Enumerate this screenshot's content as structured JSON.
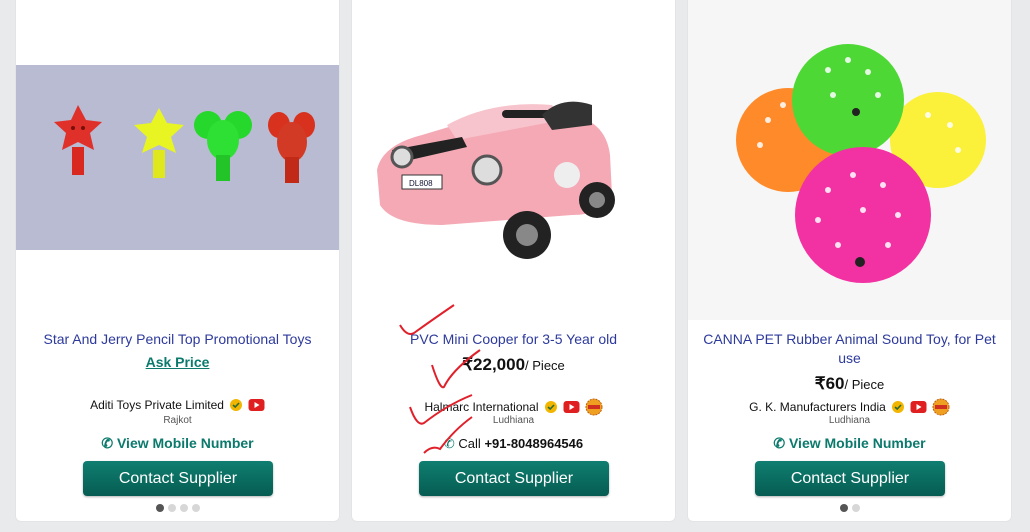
{
  "cards": [
    {
      "title": "Star And Jerry Pencil Top Promotional Toys",
      "ask_price": "Ask Price",
      "supplier": "Aditi Toys Private Limited",
      "city": "Rajkot",
      "mobile_label": "View Mobile Number",
      "button": "Contact Supplier"
    },
    {
      "title": "PVC Mini Cooper for 3-5 Year old",
      "price": "₹22,000",
      "unit": "/ Piece",
      "supplier": "Halmarc International",
      "city": "Ludhiana",
      "call_prefix": "Call",
      "phone": "+91-8048964546",
      "plate": "DL808",
      "button": "Contact Supplier"
    },
    {
      "title": "CANNA PET Rubber Animal Sound Toy, for Pet use",
      "price": "₹60",
      "unit": "/ Piece",
      "supplier": "G. K. Manufacturers India",
      "city": "Ludhiana",
      "mobile_label": "View Mobile Number",
      "button": "Contact Supplier"
    }
  ],
  "colors": {
    "button": "#0b6e63",
    "title_link": "#2d3a9c",
    "accent_green": "#0b7a6c",
    "annotation_red": "#e0202a"
  },
  "icons": [
    "phone-icon",
    "verified-icon",
    "youtube-icon",
    "trustseal-icon",
    "checkmark-annotation"
  ]
}
